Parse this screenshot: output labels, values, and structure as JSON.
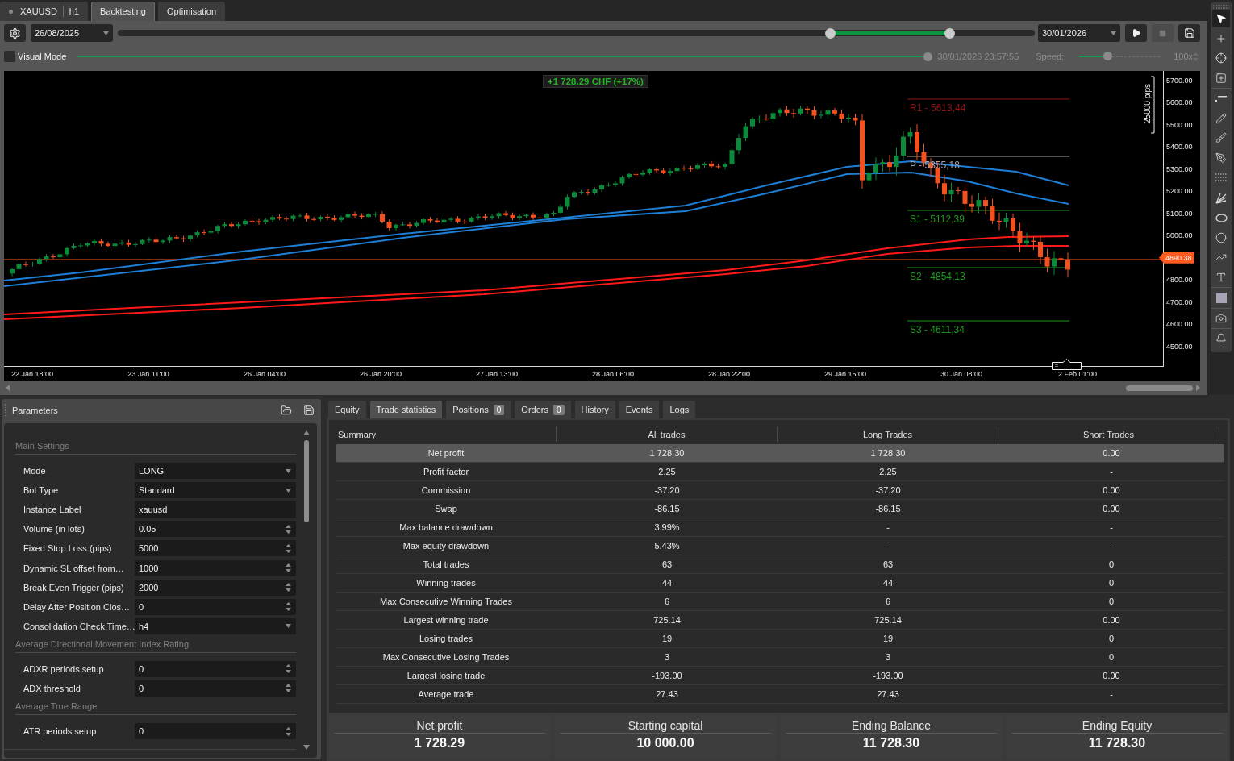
{
  "tabs": [
    {
      "kind": "instrument",
      "label": "XAUUSD",
      "timeframe": "h1",
      "selected": false
    },
    {
      "kind": "mode",
      "label": "Backtesting",
      "selected": true
    },
    {
      "kind": "mode",
      "label": "Optimisation",
      "selected": false
    }
  ],
  "backtest": {
    "start_date": "26/08/2025",
    "period_handles": [
      {
        "level": 0.777
      },
      {
        "level": 0.907
      }
    ],
    "end_date": "30/01/2026",
    "buttons": [
      {
        "disabled": false
      },
      {
        "disabled": true
      },
      {
        "disabled": false
      }
    ]
  },
  "visual_mode": {
    "label": "Visual Mode",
    "checked": false
  },
  "playback": {
    "disabled": true,
    "progress": {
      "level": 1
    },
    "timestamp": "30/01/2026 23:57:55",
    "speed_label": "Speed:",
    "speed": {
      "level": 0.35
    },
    "speed_reading": "100x"
  },
  "chart": {
    "profit_badge": "+1 728.29 CHF (+17%)",
    "ruler_label": "25000 pips",
    "pivot_levels": [
      {
        "label": "R1 - 5613,44",
        "color": "#8e1414"
      },
      {
        "label": "P - 5355,18",
        "color": "#a3a3ad"
      },
      {
        "label": "S1 - 5112,39",
        "color": "#1f9a1f"
      },
      {
        "label": "S2 - 4854,13",
        "color": "#1f9a1f"
      },
      {
        "label": "S3 - 4611,34",
        "color": "#1f9a1f"
      }
    ],
    "price_axis": [
      {
        "kind": "tick",
        "label": "5700.00"
      },
      {
        "kind": "tick",
        "label": "5600.00"
      },
      {
        "kind": "tick",
        "label": "5500.00"
      },
      {
        "kind": "tick",
        "label": "5400.00"
      },
      {
        "kind": "tick",
        "label": "5300.00"
      },
      {
        "kind": "tick",
        "label": "5200.00"
      },
      {
        "kind": "tick",
        "label": "5100.00"
      },
      {
        "kind": "tick",
        "label": "5000.00"
      },
      {
        "kind": "current",
        "label": "4890.38"
      },
      {
        "kind": "tick",
        "label": "4800.00"
      },
      {
        "kind": "tick",
        "label": "4700.00"
      },
      {
        "kind": "tick",
        "label": "4600.00"
      },
      {
        "kind": "tick",
        "label": "4500.00"
      }
    ],
    "time_axis": [
      "22 Jan 18:00",
      "23 Jan 11:00",
      "26 Jan 04:00",
      "26 Jan 20:00",
      "27 Jan 13:00",
      "28 Jan 06:00",
      "28 Jan 22:00",
      "29 Jan 15:00",
      "30 Jan 08:00",
      "2 Feb 01:00"
    ]
  },
  "drawing_tools": [
    {
      "tools": [
        {
          "selected": true
        },
        {
          "selected": false
        },
        {
          "selected": false
        },
        {
          "selected": false
        }
      ]
    },
    {
      "tools": [
        {
          "selected": false
        },
        {
          "selected": false
        },
        {
          "selected": false
        },
        {
          "selected": false
        }
      ]
    },
    {
      "tools": [
        {
          "selected": false
        },
        {
          "selected": false
        },
        {
          "selected": false
        },
        {
          "selected": false
        },
        {
          "selected": false
        },
        {
          "selected": false
        }
      ]
    },
    {
      "tools": [
        {
          "selected": false
        }
      ]
    },
    {
      "tools": [
        {
          "selected": false
        }
      ]
    },
    {
      "tools": [
        {
          "selected": false
        }
      ]
    }
  ],
  "parameters": {
    "title": "Parameters",
    "sections": [
      {
        "title": "Main Settings",
        "rows": [
          {
            "label": "Mode",
            "kind": "select",
            "value": "LONG"
          },
          {
            "label": "Bot Type",
            "kind": "select",
            "value": "Standard"
          },
          {
            "label": "Instance Label",
            "kind": "text",
            "value": "xauusd"
          },
          {
            "label": "Volume (in lots)",
            "kind": "number",
            "value": "0.05"
          },
          {
            "label": "Fixed Stop Loss (pips)",
            "kind": "number",
            "value": "5000"
          },
          {
            "label": "Dynamic SL offset from…",
            "kind": "number",
            "value": "1000"
          },
          {
            "label": "Break Even Trigger (pips)",
            "kind": "number",
            "value": "2000"
          },
          {
            "label": "Delay After Position Clos…",
            "kind": "number",
            "value": "0"
          },
          {
            "label": "Consolidation Check Time…",
            "kind": "select",
            "value": "h4"
          }
        ]
      },
      {
        "title": "Average Directional Movement Index Rating",
        "rows": [
          {
            "label": "ADXR periods setup",
            "kind": "number",
            "value": "0"
          },
          {
            "label": "ADX threshold",
            "kind": "number",
            "value": "0"
          }
        ]
      },
      {
        "title": "Average True Range",
        "rows": [
          {
            "label": "ATR periods setup",
            "kind": "number",
            "value": "0"
          }
        ]
      }
    ]
  },
  "results": {
    "tabs": [
      {
        "label": "Equity",
        "selected": false
      },
      {
        "label": "Trade statistics",
        "selected": true
      },
      {
        "label": "Positions",
        "count": "0",
        "selected": false
      },
      {
        "label": "Orders",
        "count": "0",
        "selected": false
      },
      {
        "label": "History",
        "selected": false
      },
      {
        "label": "Events",
        "selected": false
      },
      {
        "label": "Logs",
        "selected": false
      }
    ],
    "table": {
      "columns": [
        "Summary",
        "All trades",
        "Long Trades",
        "Short Trades"
      ],
      "rows": [
        {
          "cells": [
            "Net profit",
            "1 728.30",
            "1 728.30",
            "0.00"
          ],
          "selected": true
        },
        {
          "cells": [
            "Profit factor",
            "2.25",
            "2.25",
            "-"
          ],
          "selected": false
        },
        {
          "cells": [
            "Commission",
            "-37.20",
            "-37.20",
            "0.00"
          ],
          "selected": false
        },
        {
          "cells": [
            "Swap",
            "-86.15",
            "-86.15",
            "0.00"
          ],
          "selected": false
        },
        {
          "cells": [
            "Max balance drawdown",
            "3.99%",
            "-",
            "-"
          ],
          "selected": false
        },
        {
          "cells": [
            "Max equity drawdown",
            "5.43%",
            "-",
            "-"
          ],
          "selected": false
        },
        {
          "cells": [
            "Total trades",
            "63",
            "63",
            "0"
          ],
          "selected": false
        },
        {
          "cells": [
            "Winning trades",
            "44",
            "44",
            "0"
          ],
          "selected": false
        },
        {
          "cells": [
            "Max Consecutive Winning Trades",
            "6",
            "6",
            "0"
          ],
          "selected": false
        },
        {
          "cells": [
            "Largest winning trade",
            "725.14",
            "725.14",
            "0.00"
          ],
          "selected": false
        },
        {
          "cells": [
            "Losing trades",
            "19",
            "19",
            "0"
          ],
          "selected": false
        },
        {
          "cells": [
            "Max Consecutive Losing Trades",
            "3",
            "3",
            "0"
          ],
          "selected": false
        },
        {
          "cells": [
            "Largest losing trade",
            "-193.00",
            "-193.00",
            "0.00"
          ],
          "selected": false
        },
        {
          "cells": [
            "Average trade",
            "27.43",
            "27.43",
            "-"
          ],
          "selected": false
        }
      ]
    },
    "summary_cards": [
      {
        "title": "Net profit",
        "value": "1 728.29"
      },
      {
        "title": "Starting capital",
        "value": "10 000.00"
      },
      {
        "title": "Ending Balance",
        "value": "11 728.30"
      },
      {
        "title": "Ending Equity",
        "value": "11 728.30"
      }
    ]
  }
}
